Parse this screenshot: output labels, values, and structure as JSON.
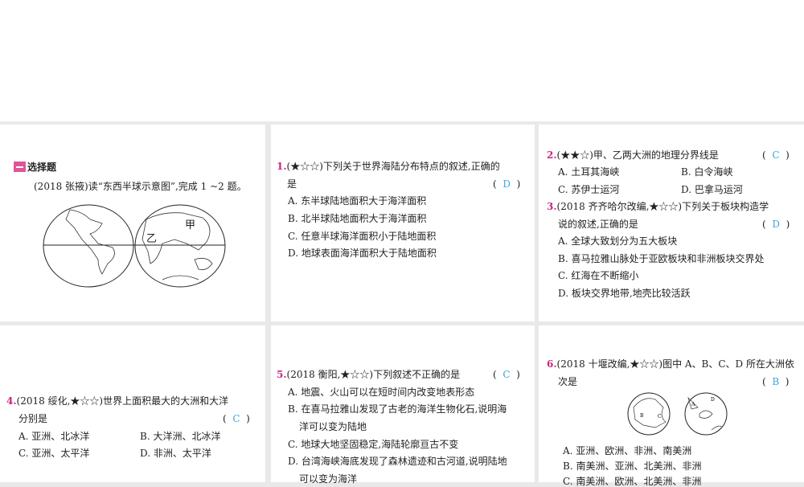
{
  "section": {
    "title": "选择题"
  },
  "intro": "(2018 张掖)读“东西半球示意图”,完成 1 ~2 题。",
  "map1": {
    "labels": [
      "甲",
      "乙"
    ]
  },
  "questions": [
    {
      "num": "1.",
      "stem1": "(★☆☆)下列关于世界海陆分布特点的叙述,正确的",
      "stem2": "是",
      "answer": "D",
      "options": [
        "A. 东半球陆地面积大于海洋面积",
        "B. 北半球陆地面积大于海洋面积",
        "C. 任意半球海洋面积小于陆地面积",
        "D. 地球表面海洋面积大于陆地面积"
      ]
    },
    {
      "num": "2.",
      "stem1": "(★★☆)甲、乙两大洲的地理分界线是",
      "answer": "C",
      "options": [
        "A. 土耳其海峡",
        "B. 白令海峡",
        "C. 苏伊士运河",
        "D. 巴拿马运河"
      ]
    },
    {
      "num": "3.",
      "stem1": "(2018 齐齐哈尔改编,★☆☆)下列关于板块构造学",
      "stem2": "说的叙述,正确的是",
      "answer": "D",
      "options": [
        "A. 全球大致划分为五大板块",
        "B. 喜马拉雅山脉处于亚欧板块和非洲板块交界处",
        "C. 红海在不断缩小",
        "D. 板块交界地带,地壳比较活跃"
      ]
    },
    {
      "num": "4.",
      "stem1": "(2018 绥化,★☆☆)世界上面积最大的大洲和大洋",
      "stem2": "分别是",
      "answer": "C",
      "options": [
        "A. 亚洲、北冰洋",
        "B. 大洋洲、北冰洋",
        "C. 亚洲、太平洋",
        "D. 非洲、太平洋"
      ]
    },
    {
      "num": "5.",
      "stem1": "(2018 衡阳,★☆☆)下列叙述不正确的是",
      "answer": "C",
      "options": [
        "A. 地震、火山可以在短时间内改变地表形态",
        "B. 在喜马拉雅山发现了古老的海洋生物化石,说明海",
        "洋可以变为陆地",
        "C. 地球大地坚固稳定,海陆轮廓亘古不变",
        "D. 台湾海峡海底发现了森林遗迹和古河道,说明陆地",
        "可以变为海洋"
      ]
    },
    {
      "num": "6.",
      "stem1": "(2018 十堰改编,★☆☆)图中 A、B、C、D 所在大洲依",
      "stem2": "次是",
      "answer": "B",
      "options": [
        "A. 亚洲、欧洲、非洲、南美洲",
        "B. 南美洲、亚洲、北美洲、非洲",
        "C. 南美洲、欧洲、北美洲、非洲"
      ]
    }
  ],
  "map6": {
    "labels": [
      "A",
      "B",
      "C",
      "D"
    ]
  }
}
